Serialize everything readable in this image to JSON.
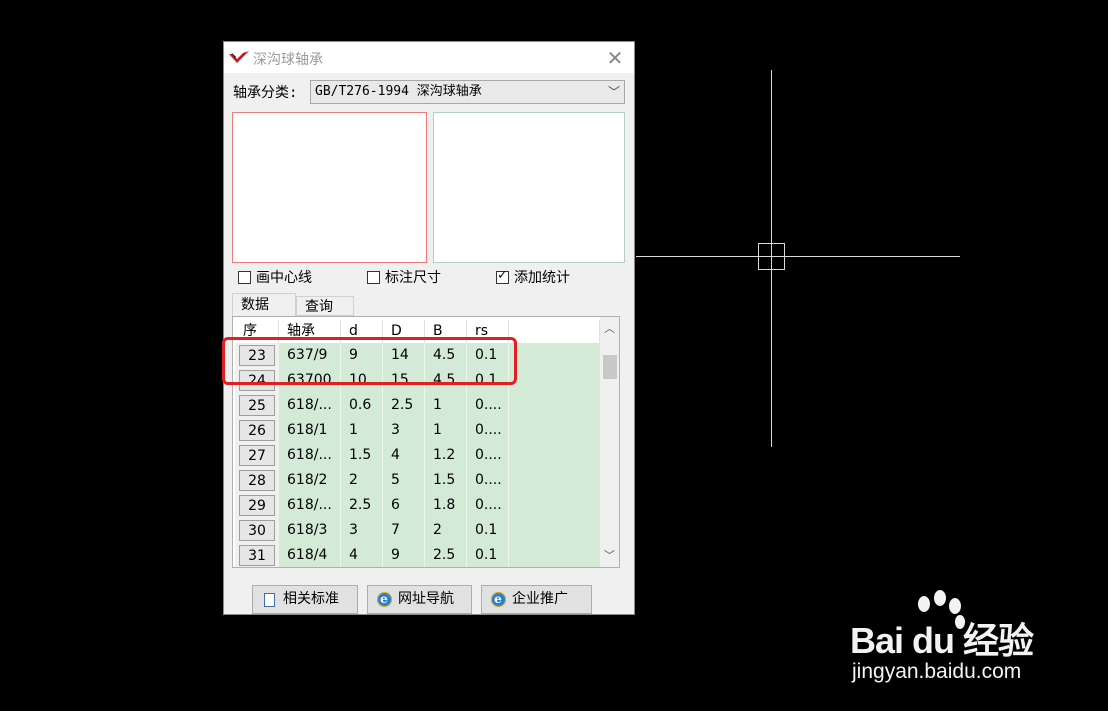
{
  "dialog": {
    "title": "深沟球轴承",
    "category_label": "轴承分类:",
    "category_value": "GB/T276-1994 深沟球轴承",
    "checkboxes": [
      {
        "label": "画中心线",
        "checked": false
      },
      {
        "label": "标注尺寸",
        "checked": false
      },
      {
        "label": "添加统计",
        "checked": true
      }
    ],
    "tabs": [
      "数据",
      "查询"
    ],
    "table": {
      "headers": [
        "序",
        "轴承",
        "d",
        "D",
        "B",
        "rs"
      ],
      "rows": [
        [
          "23",
          "637/9",
          "9",
          "14",
          "4.5",
          "0.1"
        ],
        [
          "24",
          "63700",
          "10",
          "15",
          "4.5",
          "0.1"
        ],
        [
          "25",
          "618/...",
          "0.6",
          "2.5",
          "1",
          "0...."
        ],
        [
          "26",
          "618/1",
          "1",
          "3",
          "1",
          "0...."
        ],
        [
          "27",
          "618/...",
          "1.5",
          "4",
          "1.2",
          "0...."
        ],
        [
          "28",
          "618/2",
          "2",
          "5",
          "1.5",
          "0...."
        ],
        [
          "29",
          "618/...",
          "2.5",
          "6",
          "1.8",
          "0...."
        ],
        [
          "30",
          "618/3",
          "3",
          "7",
          "2",
          "0.1"
        ],
        [
          "31",
          "618/4",
          "4",
          "9",
          "2.5",
          "0.1"
        ]
      ]
    },
    "buttons": [
      "相关标准",
      "网址导航",
      "企业推广"
    ]
  },
  "watermark": {
    "brand": "Bai  du 经验",
    "url": "jingyan.baidu.com"
  },
  "colors": {
    "highlight": "#e02020",
    "row_fill": "#d3ead6"
  }
}
